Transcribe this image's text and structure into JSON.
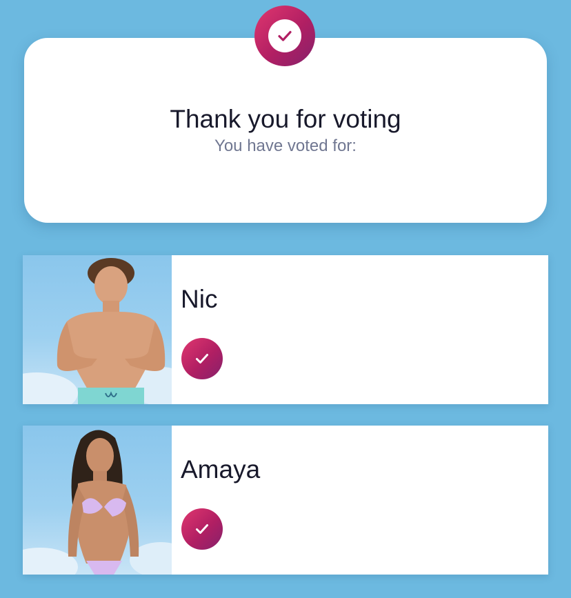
{
  "header": {
    "badge_icon": "check-icon",
    "title": "Thank you for voting",
    "subtitle": "You have voted for:"
  },
  "votes": [
    {
      "name": "Nic",
      "photo": "contestant-photo",
      "status_icon": "check-icon"
    },
    {
      "name": "Amaya",
      "photo": "contestant-photo",
      "status_icon": "check-icon"
    }
  ],
  "colors": {
    "background": "#6cb9e0",
    "card": "#ffffff",
    "accent_start": "#e0376f",
    "accent_end": "#85206b",
    "title_text": "#18192b",
    "subtitle_text": "#707791"
  }
}
